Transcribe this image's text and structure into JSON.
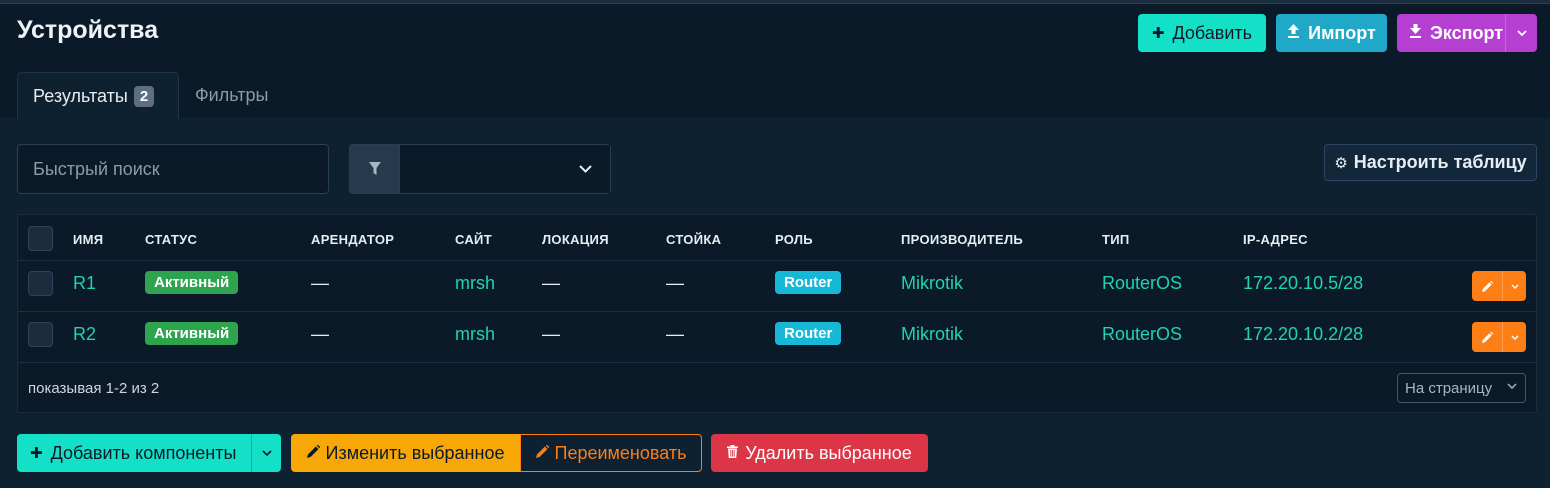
{
  "page": {
    "title": "Устройства"
  },
  "header_buttons": {
    "add": "Добавить",
    "import": "Импорт",
    "export": "Экспорт"
  },
  "tabs": {
    "results_label": "Результаты",
    "results_count": "2",
    "filters_label": "Фильтры"
  },
  "search": {
    "placeholder": "Быстрый поиск"
  },
  "configure_table": "Настроить таблицу",
  "table": {
    "columns": [
      "ИМЯ",
      "СТАТУС",
      "АРЕНДАТОР",
      "САЙТ",
      "ЛОКАЦИЯ",
      "СТОЙКА",
      "РОЛЬ",
      "ПРОИЗВОДИТЕЛЬ",
      "ТИП",
      "IP-АДРЕС"
    ],
    "rows": [
      {
        "name": "R1",
        "status": "Активный",
        "tenant": "—",
        "site": "mrsh",
        "location": "—",
        "rack": "—",
        "role": "Router",
        "manufacturer": "Mikrotik",
        "type": "RouterOS",
        "ip": "172.20.10.5/28"
      },
      {
        "name": "R2",
        "status": "Активный",
        "tenant": "—",
        "site": "mrsh",
        "location": "—",
        "rack": "—",
        "role": "Router",
        "manufacturer": "Mikrotik",
        "type": "RouterOS",
        "ip": "172.20.10.2/28"
      }
    ]
  },
  "pagination": {
    "showing": "показывая 1-2 из 2",
    "per_page": "На страницу"
  },
  "bulk_actions": {
    "add_components": "Добавить компоненты",
    "edit_selected": "Изменить выбранное",
    "rename": "Переименовать",
    "delete_selected": "Удалить выбранное"
  },
  "colors": {
    "background": "#0b1a29",
    "accent_teal": "#14e0c8",
    "import_blue": "#20a8c8",
    "export_purple": "#b43fd0",
    "status_green": "#2ea44f",
    "role_cyan": "#17b8d6",
    "edit_orange": "#fd7e14",
    "edit_yellow": "#f7a707",
    "delete_red": "#dc3545",
    "link_teal": "#1fd3b5"
  },
  "icons": {
    "add": "plus-icon",
    "import": "upload-icon",
    "export": "download-icon",
    "filter": "filter-icon",
    "configure": "gear-icon",
    "edit": "pencil-icon",
    "delete": "trash-icon",
    "dropdown": "chevron-down-icon"
  }
}
